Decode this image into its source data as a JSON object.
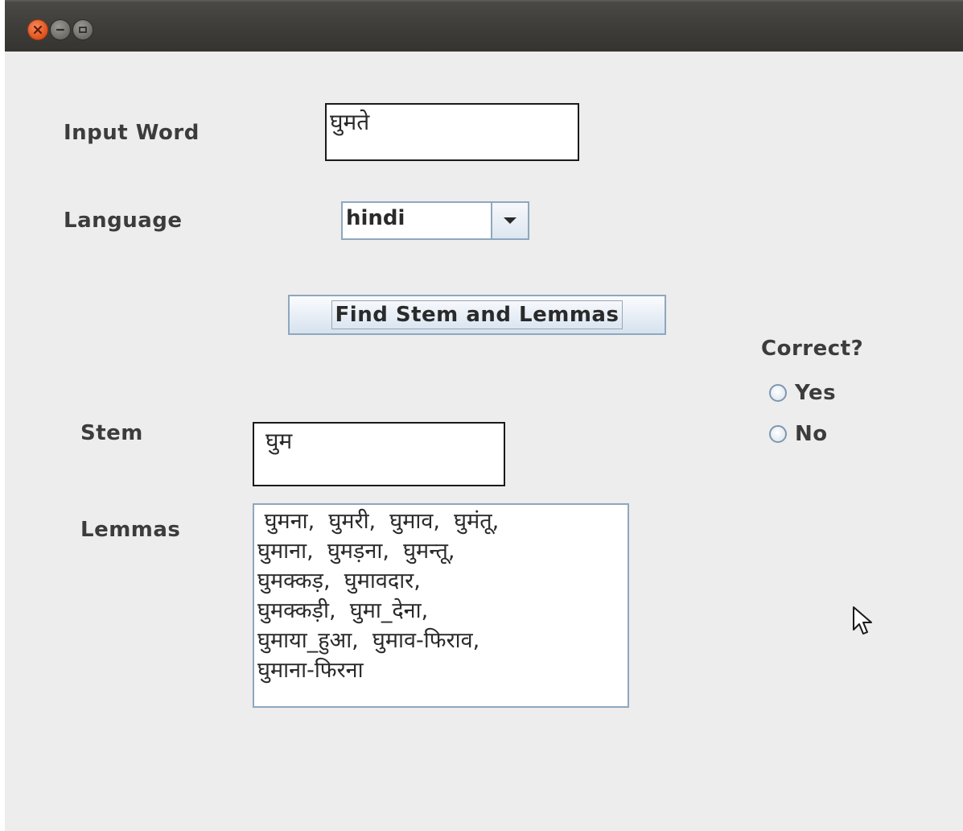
{
  "window": {
    "controls": {
      "close_icon": "close-icon",
      "minimize_icon": "minimize-icon",
      "maximize_icon": "maximize-icon"
    }
  },
  "form": {
    "input_word_label": "Input Word",
    "input_word_value": "घुमते",
    "language_label": "Language",
    "language_selected": "hindi",
    "find_button_label": "Find Stem and Lemmas",
    "stem_label": "Stem",
    "stem_value": "घुम",
    "lemmas_label": "Lemmas",
    "lemmas_value": " घुमना,  घुमरी,  घुमाव,  घुमंतू,\nघुमाना,  घुमड़ना,  घुमन्तू,\nघुमक्कड़,  घुमावदार,\nघुमक्कड़ी,  घुमा_देना,\nघुमाया_हुआ,  घुमाव-फिराव,\nघुमाना-फिरना"
  },
  "feedback": {
    "question": "Correct?",
    "options": [
      {
        "label": "Yes",
        "selected": false
      },
      {
        "label": "No",
        "selected": false
      }
    ]
  },
  "colors": {
    "close_button": "#e0521c",
    "titlebar": "#3c3b37",
    "window_bg": "#ededed",
    "control_border": "#8ea7bf"
  }
}
